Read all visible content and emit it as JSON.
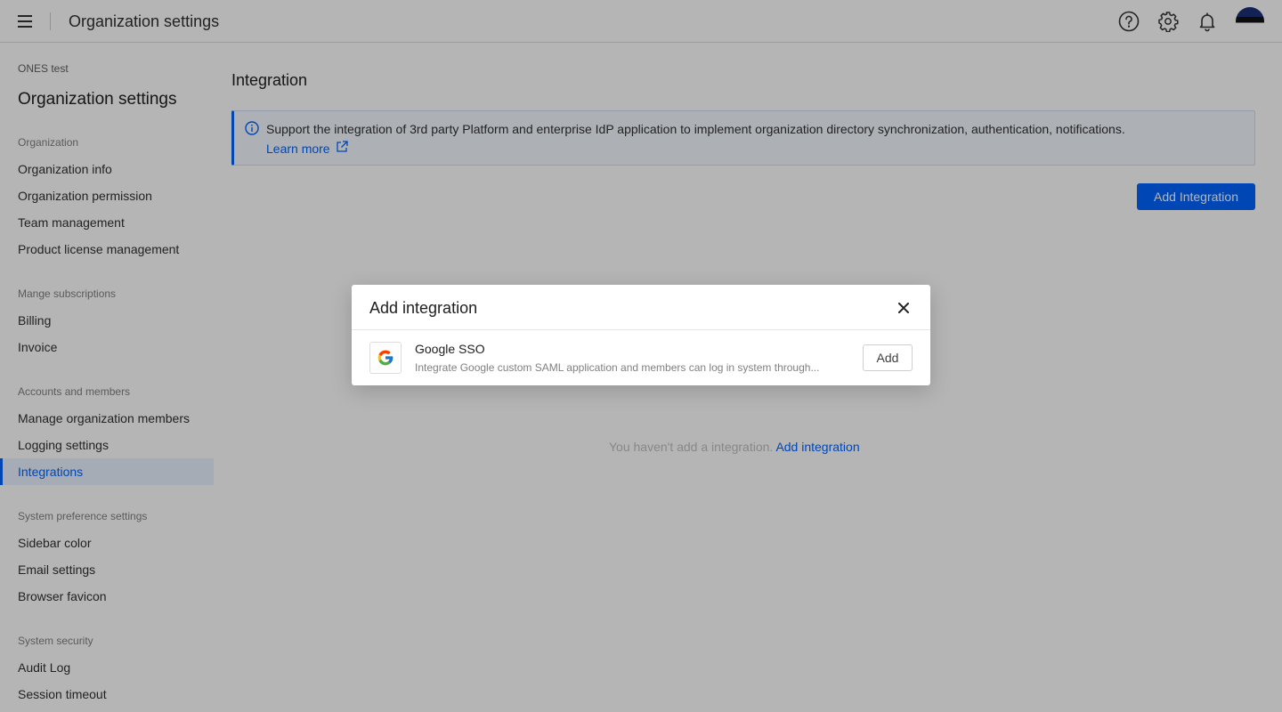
{
  "topbar": {
    "title": "Organization settings",
    "icons": [
      "menu-icon",
      "help-icon",
      "gear-icon",
      "bell-icon",
      "avatar"
    ]
  },
  "sidebar": {
    "org_name": "ONES test",
    "title": "Organization settings",
    "sections": [
      {
        "label": "Organization",
        "items": [
          "Organization info",
          "Organization permission",
          "Team management",
          "Product license management"
        ]
      },
      {
        "label": "Mange subscriptions",
        "items": [
          "Billing",
          "Invoice"
        ]
      },
      {
        "label": "Accounts and members",
        "items": [
          "Manage organization members",
          "Logging settings",
          "Integrations"
        ]
      },
      {
        "label": "System preference settings",
        "items": [
          "Sidebar color",
          "Email settings",
          "Browser favicon"
        ]
      },
      {
        "label": "System security",
        "items": [
          "Audit Log",
          "Session timeout"
        ]
      }
    ],
    "active_item": "Integrations"
  },
  "main": {
    "title": "Integration",
    "banner": {
      "text": "Support the integration of 3rd party Platform and enterprise IdP application to implement organization directory synchronization, authentication, notifications.",
      "link": "Learn more"
    },
    "add_button": "Add Integration",
    "empty_text": "You haven't add a integration.",
    "empty_link": "Add integration"
  },
  "modal": {
    "title": "Add integration",
    "items": [
      {
        "name": "Google SSO",
        "description": "Integrate Google custom SAML application and members can log in system through...",
        "button": "Add"
      }
    ]
  },
  "colors": {
    "primary": "#0064ff",
    "overlay": "rgba(0,0,0,0.29)"
  }
}
